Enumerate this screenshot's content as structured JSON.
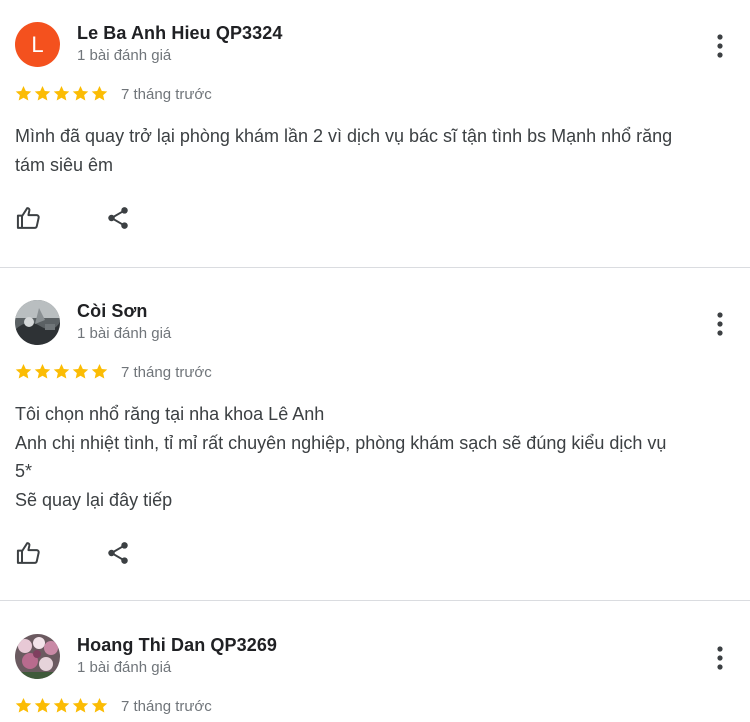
{
  "reviews": [
    {
      "author": "Le Ba Anh Hieu QP3324",
      "review_count": "1 bài đánh giá",
      "avatar_letter": "L",
      "avatar_color": "#f4511e",
      "rating": 5,
      "time": "7 tháng trước",
      "lines": [
        "Mình đã quay trở lại phòng khám lần 2 vì dịch vụ bác sĩ tận tình bs Mạnh nhổ răng",
        "tám siêu êm"
      ]
    },
    {
      "author": "Còi Sơn",
      "review_count": "1 bài đánh giá",
      "avatar_color": "#4a4f52",
      "rating": 5,
      "time": "7 tháng trước",
      "lines": [
        "Tôi chọn nhổ răng tại nha khoa Lê Anh",
        "Anh chị nhiệt tình, tỉ mỉ rất chuyên nghiệp, phòng khám sạch sẽ đúng kiểu dịch vụ",
        "5*",
        "Sẽ quay lại đây tiếp"
      ]
    },
    {
      "author": "Hoang Thi Dan QP3269",
      "review_count": "1 bài đánh giá",
      "avatar_color": "#8a6d7a",
      "rating": 5,
      "time": "7 tháng trước"
    }
  ],
  "colors": {
    "star": "#fbbc04",
    "icon": "#5f6368",
    "divider": "#dadce0"
  },
  "icons": {
    "like": "thumb-up-outline-icon",
    "share": "share-icon",
    "more": "more-vert-icon",
    "star": "star-icon"
  }
}
